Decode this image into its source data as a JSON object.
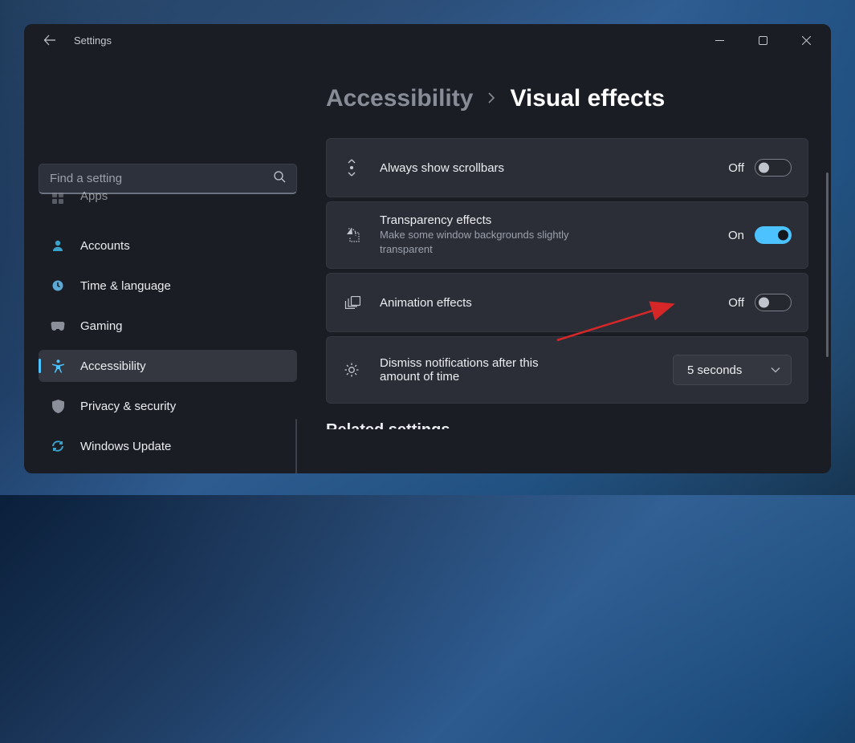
{
  "app": {
    "title": "Settings"
  },
  "search": {
    "placeholder": "Find a setting"
  },
  "sidebar": {
    "items": [
      {
        "label": "Apps",
        "icon": "apps-icon"
      },
      {
        "label": "Accounts",
        "icon": "person-icon"
      },
      {
        "label": "Time & language",
        "icon": "clock-icon"
      },
      {
        "label": "Gaming",
        "icon": "gamepad-icon"
      },
      {
        "label": "Accessibility",
        "icon": "accessibility-icon"
      },
      {
        "label": "Privacy & security",
        "icon": "shield-icon"
      },
      {
        "label": "Windows Update",
        "icon": "update-icon"
      }
    ],
    "selected_index": 4
  },
  "breadcrumb": {
    "parent": "Accessibility",
    "current": "Visual effects"
  },
  "settings": {
    "scrollbars": {
      "title": "Always show scrollbars",
      "state_label": "Off",
      "on": false
    },
    "transparency": {
      "title": "Transparency effects",
      "description": "Make some window backgrounds slightly transparent",
      "state_label": "On",
      "on": true
    },
    "animation": {
      "title": "Animation effects",
      "state_label": "Off",
      "on": false
    },
    "notifications": {
      "title": "Dismiss notifications after this amount of time",
      "selected_value": "5 seconds"
    }
  },
  "cut_section": {
    "title": "Related settings"
  }
}
